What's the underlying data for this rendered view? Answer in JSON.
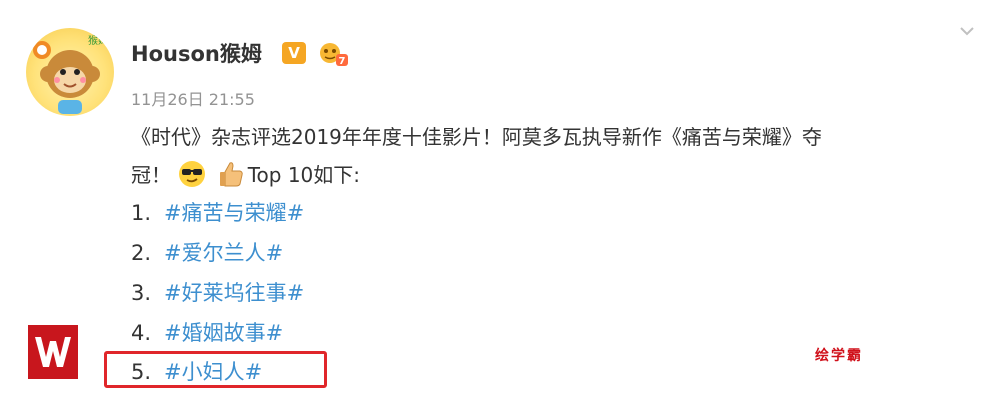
{
  "post": {
    "author": {
      "name": "Houson猴姆",
      "avatar_icon": "monkey-avatar-icon",
      "verified_badge": "V",
      "level_badge": "7"
    },
    "timestamp": "11月26日 21:55",
    "text_line1": "《时代》杂志评选2019年年度十佳影片！阿莫多瓦执导新作《痛苦与荣耀》夺",
    "text_line2_prefix": "冠！",
    "text_line2_suffix": "Top 10如下:",
    "emojis": [
      "cool-sunglasses-emoji",
      "thumbs-up-emoji"
    ],
    "ranking": [
      {
        "num": "1.",
        "tag": "#痛苦与荣耀#"
      },
      {
        "num": "2.",
        "tag": "#爱尔兰人#"
      },
      {
        "num": "3.",
        "tag": "#好莱坞往事#"
      },
      {
        "num": "4.",
        "tag": "#婚姻故事#"
      },
      {
        "num": "5.",
        "tag": "#小妇人#"
      }
    ],
    "highlighted_rank": "5.",
    "more_icon": "chevron-down-icon"
  },
  "watermark": {
    "logo": "W",
    "text": "绘学霸"
  },
  "colors": {
    "tag_link": "#3d8fcf",
    "highlight_border": "#e0262a",
    "watermark_red": "#d0111b",
    "vip_badge": "#f5a623"
  }
}
